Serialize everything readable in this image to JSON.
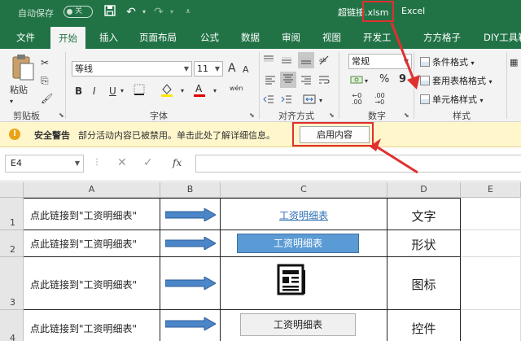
{
  "titlebar": {
    "autosave_label": "自动保存",
    "autosave_state": "关",
    "title": "超链接.xlsm",
    "app": "Excel"
  },
  "tabs": [
    "文件",
    "开始",
    "插入",
    "页面布局",
    "公式",
    "数据",
    "审阅",
    "视图",
    "开发工",
    "方方格子",
    "DIY工具箱"
  ],
  "active_tab": "开始",
  "ribbon": {
    "clipboard": {
      "paste_label": "粘贴",
      "group_label": "剪贴板"
    },
    "font": {
      "name": "等线",
      "size": "11",
      "bold": "B",
      "italic": "I",
      "underline": "U",
      "grow": "A",
      "shrink": "A",
      "color_letter": "A",
      "wen": "wén",
      "group_label": "字体"
    },
    "alignment": {
      "group_label": "对齐方式"
    },
    "number": {
      "format": "常规",
      "percent": "%",
      "comma": "9",
      "group_label": "数字"
    },
    "styles": {
      "conditional": "条件格式",
      "table": "套用表格格式",
      "cell": "单元格样式",
      "group_label": "样式"
    }
  },
  "security_bar": {
    "icon": "warning-icon",
    "title": "安全警告",
    "message": "部分活动内容已被禁用。单击此处了解详细信息。",
    "button_label": "启用内容"
  },
  "formula_bar": {
    "name_box": "E4",
    "fx": "fx",
    "value": ""
  },
  "grid": {
    "columns": [
      "A",
      "B",
      "C",
      "D",
      "E"
    ],
    "rows": [
      {
        "header": "1",
        "a": "点此链接到\"工资明细表\"",
        "c": "工资明细表",
        "c_type": "text-link",
        "d": "文字"
      },
      {
        "header": "2",
        "a": "点此链接到\"工资明细表\"",
        "c": "工资明细表",
        "c_type": "shape",
        "d": "形状"
      },
      {
        "header": "3",
        "a": "点此链接到\"工资明细表\"",
        "c": "newspaper-icon",
        "c_type": "icon",
        "d": "图标"
      },
      {
        "header": "4",
        "a": "点此链接到\"工资明细表\"",
        "c": "工资明细表",
        "c_type": "control",
        "d": "控件"
      }
    ]
  },
  "colors": {
    "excel_green": "#217346",
    "annotation_red": "#e03030",
    "arrow_blue": "#4a86c8",
    "shape_blue": "#5b9bd5"
  }
}
